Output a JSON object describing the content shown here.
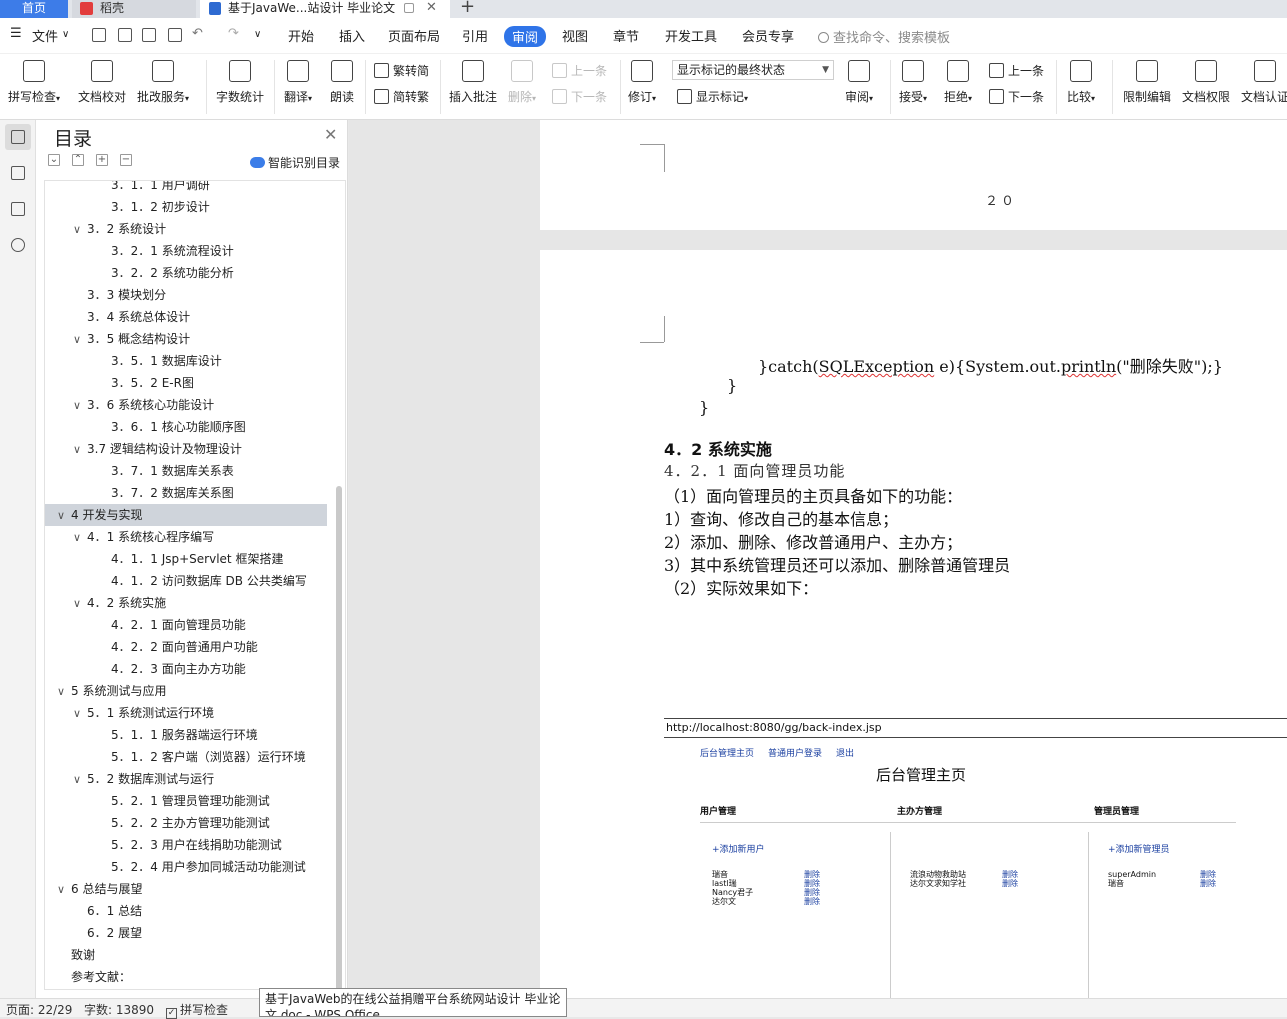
{
  "tabs": {
    "home": "首页",
    "draft": "稻壳",
    "doc": "基于JavaWe...站设计 毕业论文",
    "new_tab": "+"
  },
  "menubar": {
    "file": "文件",
    "items": [
      "开始",
      "插入",
      "页面布局",
      "引用",
      "审阅",
      "视图",
      "章节",
      "开发工具",
      "会员专享"
    ],
    "active": "审阅",
    "search_placeholder": "查找命令、搜索模板"
  },
  "ribbon": {
    "spell_check": "拼写检查",
    "doc_proof": "文档校对",
    "review_service": "批改服务",
    "word_count": "字数统计",
    "translate": "翻译",
    "read_aloud": "朗读",
    "trad_to_simp": "繁转简",
    "simp_to_trad": "简转繁",
    "insert_comment": "插入批注",
    "delete": "删除",
    "prev_comment": "上一条",
    "next_comment": "下一条",
    "track": "修订",
    "markup_select": "显示标记的最终状态",
    "show_markup": "显示标记",
    "review": "审阅",
    "accept": "接受",
    "reject": "拒绝",
    "prev_change": "上一条",
    "next_change": "下一条",
    "compare": "比较",
    "restrict_edit": "限制编辑",
    "doc_rights": "文档权限",
    "doc_cert": "文档认证"
  },
  "toc": {
    "title": "目录",
    "smart": "智能识别目录",
    "items": [
      {
        "text": "3．1．1  用户调研",
        "level": 3
      },
      {
        "text": "3．1．2  初步设计",
        "level": 3
      },
      {
        "text": "3．2    系统设计",
        "level": 2,
        "arrow": "∨"
      },
      {
        "text": "3．2．1  系统流程设计",
        "level": 3
      },
      {
        "text": "3．2．2  系统功能分析",
        "level": 3
      },
      {
        "text": "3．3    模块划分",
        "level": 2
      },
      {
        "text": "3．4    系统总体设计",
        "level": 2
      },
      {
        "text": "3．5    概念结构设计",
        "level": 2,
        "arrow": "∨"
      },
      {
        "text": "3．5．1  数据库设计",
        "level": 3
      },
      {
        "text": "3．5．2 E-R图",
        "level": 3
      },
      {
        "text": "3．6    系统核心功能设计",
        "level": 2,
        "arrow": "∨"
      },
      {
        "text": "3．6．1    核心功能顺序图",
        "level": 3
      },
      {
        "text": "3.7    逻辑结构设计及物理设计",
        "level": 2,
        "arrow": "∨"
      },
      {
        "text": "3．7．1    数据库关系表",
        "level": 3
      },
      {
        "text": "3．7．2    数据库关系图",
        "level": 3
      },
      {
        "text": "4    开发与实现",
        "level": 1,
        "arrow": "∨",
        "selected": true
      },
      {
        "text": "4．1    系统核心程序编写",
        "level": 2,
        "arrow": "∨"
      },
      {
        "text": "4．1．1    Jsp+Servlet 框架搭建",
        "level": 3
      },
      {
        "text": "4．1．2    访问数据库 DB 公共类编写",
        "level": 3
      },
      {
        "text": "4．2    系统实施",
        "level": 2,
        "arrow": "∨"
      },
      {
        "text": "4．2．1    面向管理员功能",
        "level": 3
      },
      {
        "text": "4．2．2    面向普通用户功能",
        "level": 3
      },
      {
        "text": "4．2．3    面向主办方功能",
        "level": 3
      },
      {
        "text": "5    系统测试与应用",
        "level": 1,
        "arrow": "∨"
      },
      {
        "text": "5．1    系统测试运行环境",
        "level": 2,
        "arrow": "∨"
      },
      {
        "text": "5．1．1    服务器端运行环境",
        "level": 3
      },
      {
        "text": "5．1．2    客户端（浏览器）运行环境",
        "level": 3
      },
      {
        "text": "5．2    数据库测试与运行",
        "level": 2,
        "arrow": "∨"
      },
      {
        "text": "5．2．1    管理员管理功能测试",
        "level": 3
      },
      {
        "text": "5．2．2    主办方管理功能测试",
        "level": 3
      },
      {
        "text": "5．2．3 用户在线捐助功能测试",
        "level": 3
      },
      {
        "text": "5．2．4 用户参加同城活动功能测试",
        "level": 3
      },
      {
        "text": "6    总结与展望",
        "level": 1,
        "arrow": "∨"
      },
      {
        "text": "6．1    总结",
        "level": 2
      },
      {
        "text": "6．2    展望",
        "level": 2
      },
      {
        "text": "致谢",
        "level": 1
      },
      {
        "text": "参考文献：",
        "level": 1
      }
    ]
  },
  "document": {
    "page_number": "２０",
    "code_line1_a": "}catch(",
    "code_line1_b": "SQLException",
    "code_line1_c": " e){System.out.",
    "code_line1_d": "println",
    "code_line1_e": "(\"删除失败\");}",
    "code_line2": "}",
    "code_line3": "}",
    "heading": "4．2   系统实施",
    "subheading": "4．2．1   面向管理员功能",
    "body": [
      "（1）面向管理员的主页具备如下的功能：",
      "1）查询、修改自己的基本信息；",
      "2）添加、删除、修改普通用户、主办方；",
      "3）其中系统管理员还可以添加、删除普通管理员",
      "（2）实际效果如下："
    ],
    "screenshot": {
      "url": "http://localhost:8080/gg/back-index.jsp",
      "nav": [
        "后台管理主页",
        "普通用户登录",
        "退出"
      ],
      "title": "后台管理主页",
      "sections": [
        "用户管理",
        "主办方管理",
        "管理员管理"
      ],
      "add_user": "+添加新用户",
      "add_admin": "+添加新管理员",
      "users": [
        "瑞音",
        "lastl瑞",
        "Nancy君子",
        "达尔文"
      ],
      "sponsors": [
        "流浪动物救助站",
        "达尔文求知学社"
      ],
      "admins": [
        "superAdmin",
        "瑞音"
      ],
      "delete_label": "删除"
    }
  },
  "statusbar": {
    "page": "页面: 22/29",
    "words": "字数: 13890",
    "spell": "拼写检查"
  },
  "tooltip": "基于JavaWeb的在线公益捐赠平台系统网站设计 毕业论文.doc - WPS Office"
}
